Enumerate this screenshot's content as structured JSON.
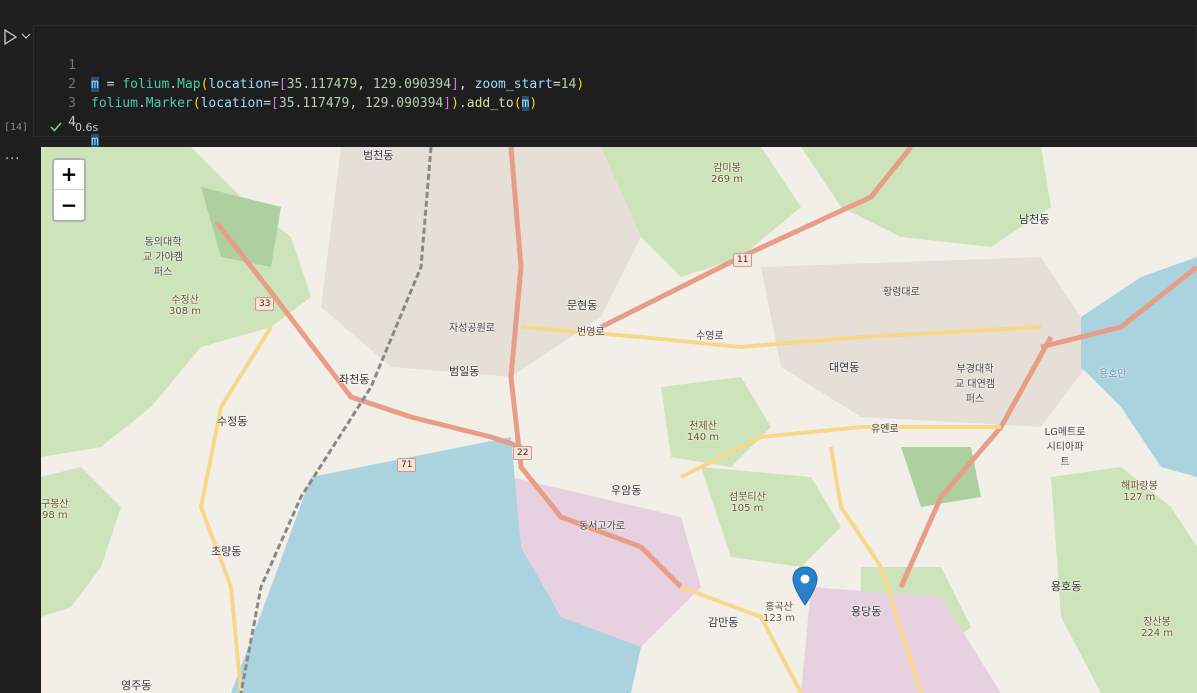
{
  "cell": {
    "execution_count": "[14]",
    "exec_time": "0.6s",
    "line_numbers": [
      "1",
      "2",
      "3",
      "4"
    ],
    "code": {
      "l1": {
        "var": "m",
        "eq": " = ",
        "mod": "folium",
        "dot": ".",
        "cls": "Map",
        "open": "(",
        "kw": "location",
        "eq2": "=",
        "lb": "[",
        "lat": "35.117479",
        "comma": ", ",
        "lon": "129.090394",
        "rb": "]",
        "sep": ", ",
        "kw2": "zoom_start",
        "eq3": "=",
        "zoom": "14",
        "close": ")"
      },
      "l2": {
        "mod": "folium",
        "dot": ".",
        "cls": "Marker",
        "open": "(",
        "kw": "location",
        "eq": "=",
        "lb": "[",
        "lat": "35.117479",
        "comma": ", ",
        "lon": "129.090394",
        "rb": "]",
        "close": ")",
        "dot2": ".",
        "fn": "add_to",
        "open2": "(",
        "arg": "m",
        "close2": ")"
      },
      "l4": {
        "var": "m"
      }
    }
  },
  "output": {
    "menu_label": "..."
  },
  "map": {
    "zoom_in_label": "+",
    "zoom_out_label": "−",
    "marker_icon": "map-pin-icon",
    "marker_color": "#2a81cb",
    "labels": {
      "beomcheon": "범천동",
      "beomil": "범일동",
      "jwacheon": "좌천동",
      "sujeong": "수정동",
      "choryang": "초량동",
      "munhyeon": "문현동",
      "uam": "우암동",
      "gamman": "감만동",
      "daeyeon": "대연동",
      "namcheon": "남천동",
      "yongho": "용호동",
      "yongdang": "용당동",
      "yeongju": "영주동",
      "jaseong": "자성공원로",
      "univ1": "동의대학교 가야캠퍼스",
      "univ2": "부경대학교 대연캠퍼스",
      "lg": "LG메트로시티아파트",
      "bay": "용호만",
      "suyeongno": "수영로",
      "yuennro": "유엔로",
      "dongseogoga": "동서고가로",
      "hwangnyeong": "황령대로",
      "beonyeongno": "번영로"
    },
    "peaks": {
      "sujeongsan": {
        "name": "수정산",
        "elev": "308 m"
      },
      "cheonjesan": {
        "name": "천제산",
        "elev": "140 m"
      },
      "sembuti": {
        "name": "섬붓티산",
        "elev": "105 m"
      },
      "hongoksan": {
        "name": "홍곡산",
        "elev": "123 m"
      },
      "gamni": {
        "name": "감미봉",
        "elev": "269 m"
      },
      "haepari": {
        "name": "해파랑봉",
        "elev": "127 m"
      },
      "jangsan": {
        "name": "장산봉",
        "elev": "224 m"
      },
      "gubong": {
        "name": "구봉산",
        "elev": "98 m"
      }
    },
    "route_shields": [
      "33",
      "11",
      "71",
      "22"
    ]
  }
}
